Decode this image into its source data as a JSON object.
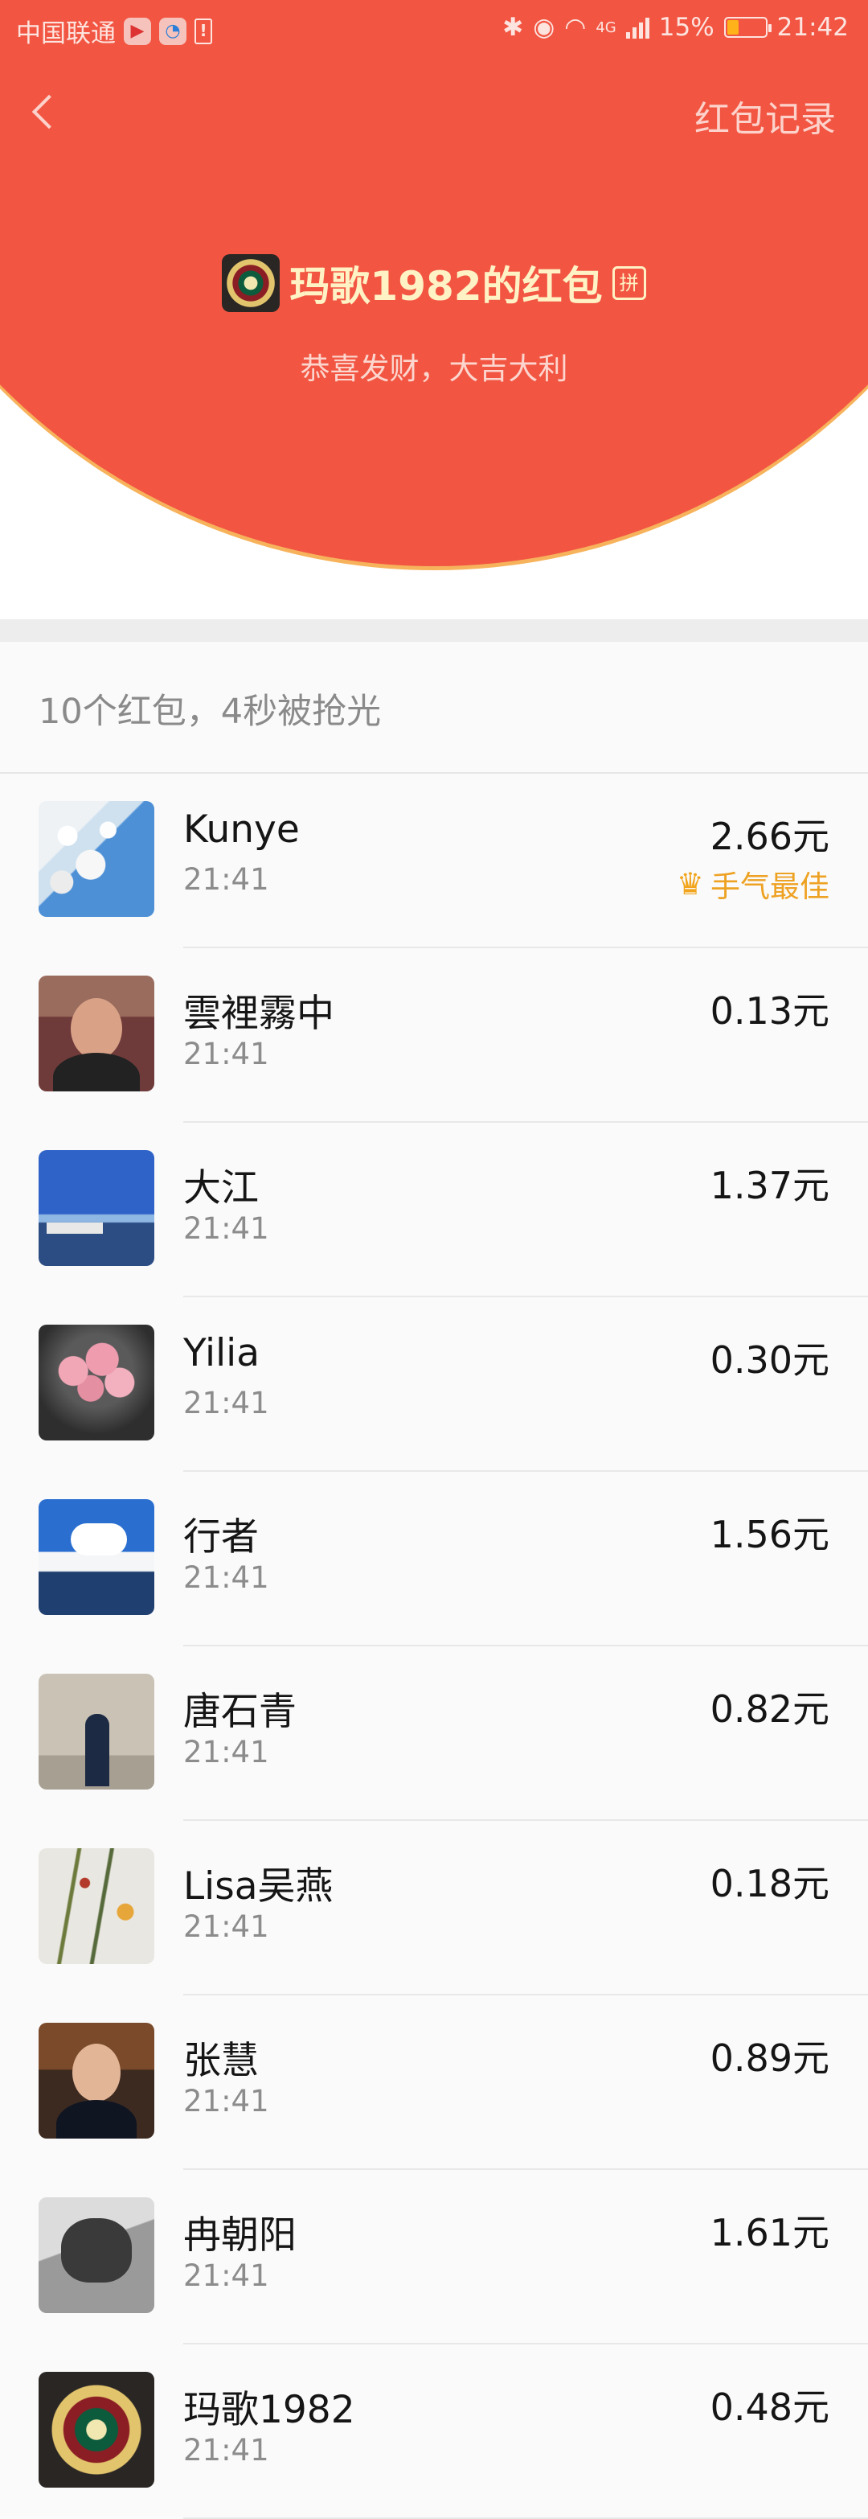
{
  "status_bar": {
    "carrier": "中国联通",
    "network": "4G",
    "battery": "15%",
    "battery_level": 0.15,
    "time": "21:42"
  },
  "header": {
    "back_icon": "chevron-left-icon",
    "record_link": "红包记录",
    "sender_title": "玛歌1982的红包",
    "pin_badge": "拼",
    "blessing": "恭喜发财，大吉大利"
  },
  "summary": "10个红包，4秒被抢光",
  "colors": {
    "header_red": "#f25643",
    "header_text": "#fff2c5",
    "best_luck": "#eea224"
  },
  "recipients": [
    {
      "name": "Kunye",
      "time": "21:41",
      "amount": "2.66元",
      "best": "手气最佳"
    },
    {
      "name": "雲裡霧中",
      "time": "21:41",
      "amount": "0.13元"
    },
    {
      "name": "大江",
      "time": "21:41",
      "amount": "1.37元"
    },
    {
      "name": "Yilia",
      "time": "21:41",
      "amount": "0.30元"
    },
    {
      "name": "行者",
      "time": "21:41",
      "amount": "1.56元"
    },
    {
      "name": "唐石青",
      "time": "21:41",
      "amount": "0.82元"
    },
    {
      "name": "Lisa吴燕",
      "time": "21:41",
      "amount": "0.18元"
    },
    {
      "name": "张慧",
      "time": "21:41",
      "amount": "0.89元"
    },
    {
      "name": "冉朝阳",
      "time": "21:41",
      "amount": "1.61元"
    },
    {
      "name": "玛歌1982",
      "time": "21:41",
      "amount": "0.48元"
    }
  ]
}
